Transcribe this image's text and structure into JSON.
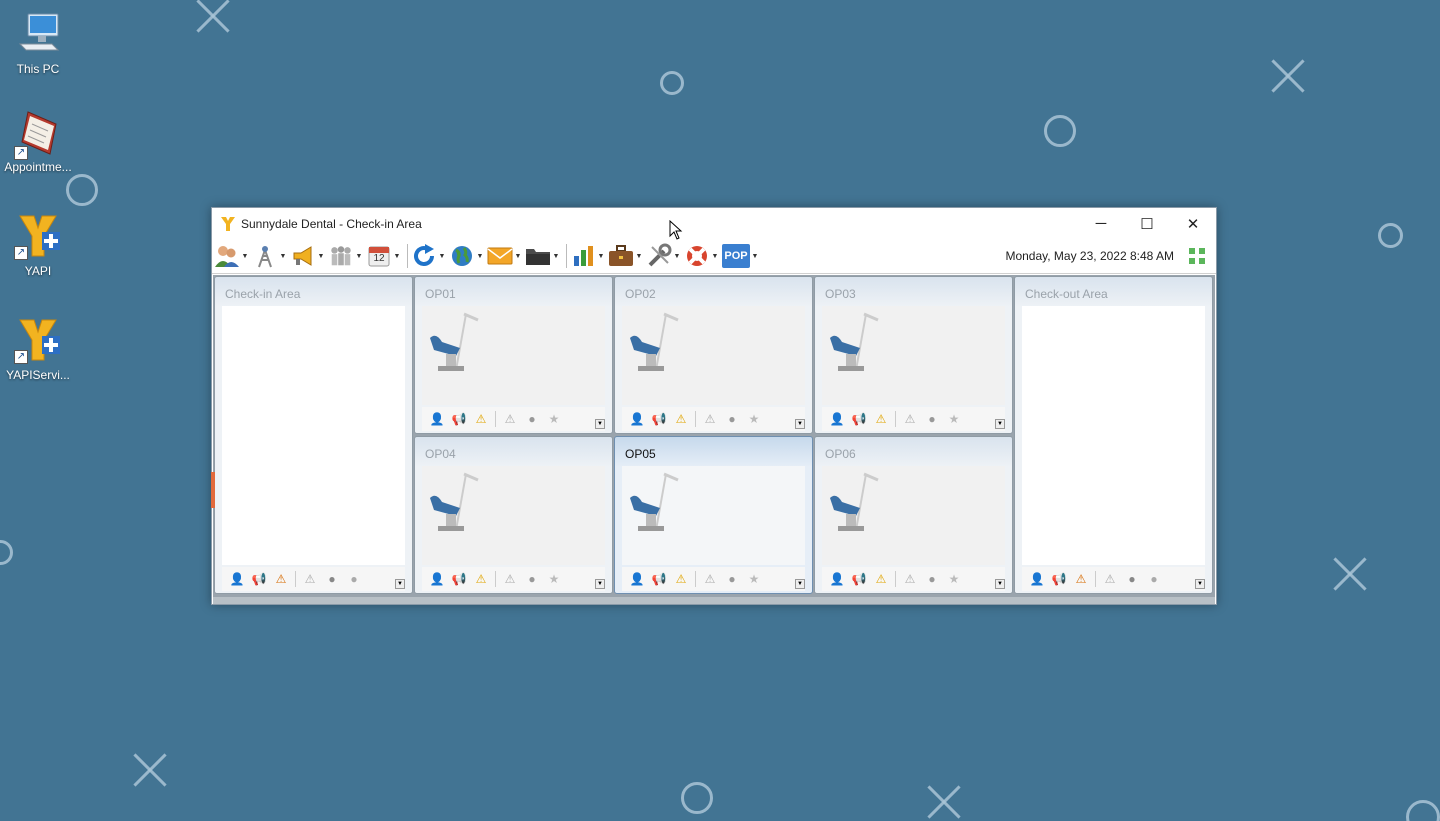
{
  "desktop": {
    "icons": [
      {
        "label": "This PC",
        "icon": "computer-icon"
      },
      {
        "label": "Appointme...",
        "icon": "appointment-book-icon"
      },
      {
        "label": "YAPI",
        "icon": "yapi-icon"
      },
      {
        "label": "YAPIServi...",
        "icon": "yapi-service-icon"
      }
    ]
  },
  "window": {
    "title": "Sunnydale Dental - Check-in Area",
    "controls": {
      "minimize": "─",
      "maximize": "☐",
      "close": "✕"
    }
  },
  "toolbar": {
    "datetime": "Monday, May 23, 2022 8:48 AM",
    "calendar_day": "12",
    "pop_label": "POP",
    "buttons": [
      "patients-icon",
      "antenna-icon",
      "megaphone-icon",
      "staff-icon",
      "calendar-icon",
      "refresh-icon",
      "globe-icon",
      "mail-icon",
      "folder-icon",
      "chart-icon",
      "briefcase-icon",
      "tools-icon",
      "help-lifebuoy-icon",
      "pop-icon"
    ]
  },
  "areas": {
    "checkin": {
      "title": "Check-in Area"
    },
    "checkout": {
      "title": "Check-out Area"
    },
    "ops": [
      {
        "title": "OP01"
      },
      {
        "title": "OP02"
      },
      {
        "title": "OP03"
      },
      {
        "title": "OP04"
      },
      {
        "title": "OP05",
        "selected": true
      },
      {
        "title": "OP06"
      }
    ]
  },
  "colors": {
    "desktop_bg": "#427493",
    "accent": "#e26a3c",
    "pop_button": "#3a7fd0"
  }
}
